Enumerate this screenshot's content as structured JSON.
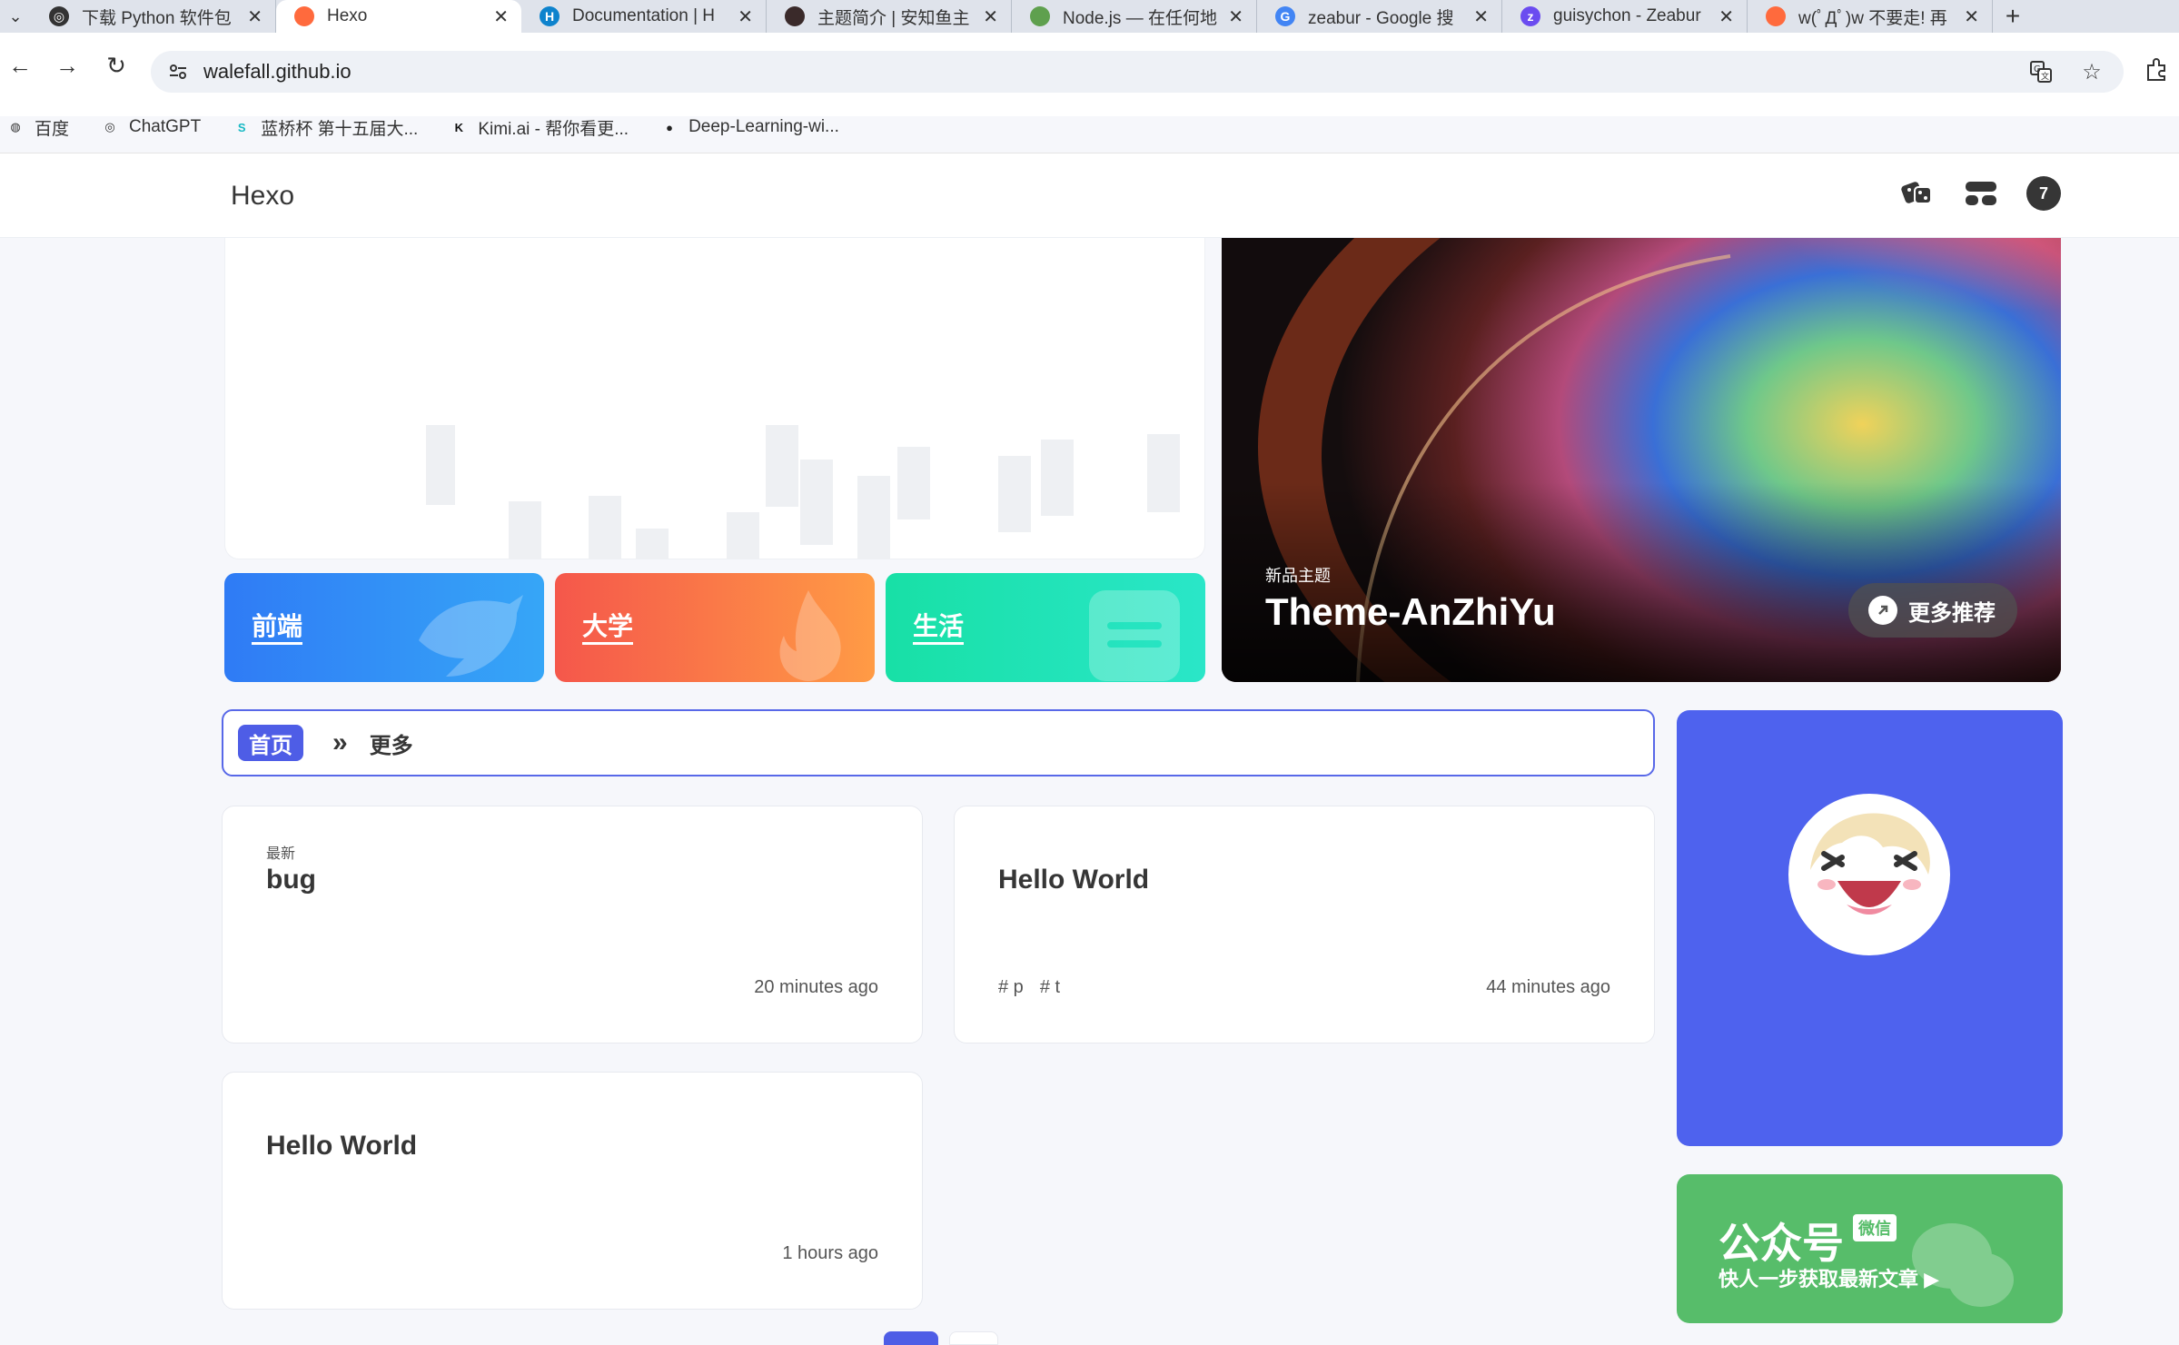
{
  "browser": {
    "tabs": [
      {
        "label": "下载 Python 软件包",
        "favicon": "chatgpt-icon",
        "fav_color": "#333333",
        "fav_glyph": "◎",
        "active": false
      },
      {
        "label": "Hexo",
        "favicon": "peach-icon",
        "fav_color": "#ff6a3d",
        "fav_glyph": "",
        "active": true
      },
      {
        "label": "Documentation | H",
        "favicon": "hexo-icon",
        "fav_color": "#0e83cd",
        "fav_glyph": "H",
        "active": false
      },
      {
        "label": "主题简介 | 安知鱼主",
        "favicon": "anzhiyu-icon",
        "fav_color": "#3a2a2a",
        "fav_glyph": "",
        "active": false
      },
      {
        "label": "Node.js — 在任何地",
        "favicon": "nodejs-icon",
        "fav_color": "#5fa04e",
        "fav_glyph": "",
        "active": false
      },
      {
        "label": "zeabur - Google 搜",
        "favicon": "google-icon",
        "fav_color": "#4285f4",
        "fav_glyph": "G",
        "active": false
      },
      {
        "label": "guisychon - Zeabur",
        "favicon": "zeabur-icon",
        "fav_color": "#6b4cf0",
        "fav_glyph": "z",
        "active": false
      },
      {
        "label": "w(ﾟДﾟ)w 不要走! 再",
        "favicon": "peach-icon",
        "fav_color": "#ff6a3d",
        "fav_glyph": "",
        "active": false
      }
    ],
    "new_tab_glyph": "+",
    "url": "walefall.github.io",
    "bookmarks": [
      {
        "label": "百度",
        "icon": "globe-icon",
        "color": "#333333",
        "glyph": "◍"
      },
      {
        "label": "ChatGPT",
        "icon": "chatgpt-icon",
        "color": "#333333",
        "glyph": "◎"
      },
      {
        "label": "蓝桥杯 第十五届大...",
        "icon": "lanqiao-icon",
        "color": "#18b9c4",
        "glyph": "S"
      },
      {
        "label": "Kimi.ai - 帮你看更...",
        "icon": "kimi-icon",
        "color": "#111111",
        "glyph": "K"
      },
      {
        "label": "Deep-Learning-wi...",
        "icon": "github-icon",
        "color": "#222222",
        "glyph": "●"
      }
    ]
  },
  "site": {
    "title": "Hexo",
    "badge_count": "7",
    "categories": [
      {
        "label": "前端",
        "color_from": "#2f7bf5",
        "color_to": "#36a6f7"
      },
      {
        "label": "大学",
        "color_from": "#f5574b",
        "color_to": "#ff9b45"
      },
      {
        "label": "生活",
        "color_from": "#18e0a6",
        "color_to": "#2ae6c8"
      }
    ],
    "feature": {
      "subtitle": "新品主题",
      "title": "Theme-AnZhiYu",
      "button": "更多推荐"
    },
    "catbar": {
      "home": "首页",
      "chevron": "»",
      "more": "更多"
    },
    "posts": [
      {
        "tag": "最新",
        "title": "bug",
        "time": "20 minutes ago",
        "tags": []
      },
      {
        "tag": "",
        "title": "Hello World",
        "time": "44 minutes ago",
        "tags": [
          "# p",
          "# t"
        ]
      },
      {
        "tag": "",
        "title": "Hello World",
        "time": "1 hours ago",
        "tags": []
      }
    ],
    "wechat": {
      "title": "公众号",
      "badge": "微信",
      "subtitle": "快人一步获取最新文章 ▶"
    }
  },
  "colors": {
    "accent": "#4e5de6",
    "profile_bg": "#4e62ee",
    "wechat_bg": "#57bd6a"
  }
}
